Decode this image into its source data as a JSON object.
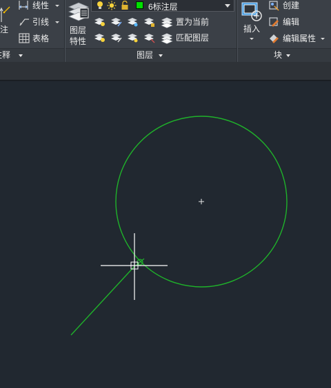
{
  "annotation": {
    "dimension_label": "标注",
    "linear_label": "线性",
    "leader_label": "引线",
    "table_label": "表格",
    "panel_title": "注释"
  },
  "layers": {
    "properties_line1": "图层",
    "properties_line2": "特性",
    "current_layer": "6标注层",
    "current_layer_color": "#00e000",
    "set_current_label": "置为当前",
    "match_layer_label": "匹配图层",
    "panel_title": "图层"
  },
  "block": {
    "insert_label": "插入",
    "create_label": "创建",
    "edit_label": "编辑",
    "edit_attributes_label": "编辑属性",
    "panel_title": "块"
  },
  "drawing": {
    "circle_color": "#1fb32a",
    "line_color": "#1fb32a",
    "crosshair_color": "#ffffff",
    "background": "#212830"
  }
}
